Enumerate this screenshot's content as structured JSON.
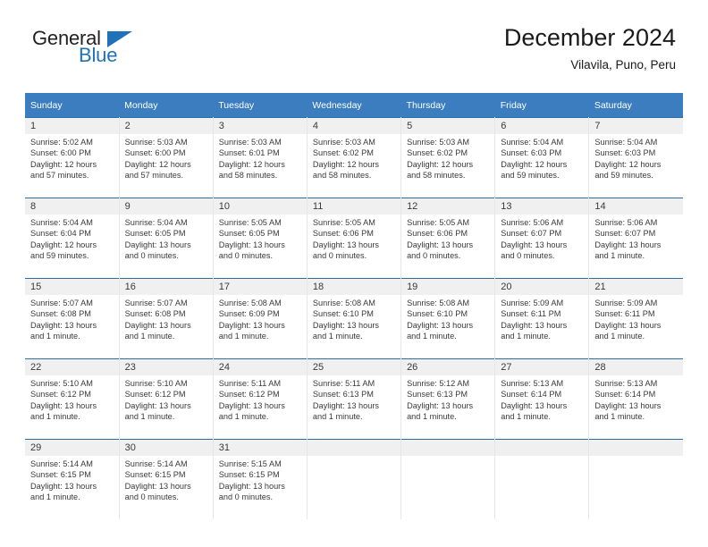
{
  "branding": {
    "name_primary": "General",
    "name_secondary": "Blue",
    "flag_icon": "triangle-flag-icon"
  },
  "header": {
    "title": "December 2024",
    "location": "Vilavila, Puno, Peru"
  },
  "colors": {
    "header_blue": "#3b7dbf",
    "row_divider_blue": "#2e6da4",
    "daynum_band": "#f0f0f0",
    "logo_blue": "#1f72b8",
    "text": "#3a3a3a"
  },
  "calendar": {
    "weekday_headers": [
      "Sunday",
      "Monday",
      "Tuesday",
      "Wednesday",
      "Thursday",
      "Friday",
      "Saturday"
    ],
    "weeks": [
      [
        {
          "day": "1",
          "sunrise": "Sunrise: 5:02 AM",
          "sunset": "Sunset: 6:00 PM",
          "daylight_1": "Daylight: 12 hours",
          "daylight_2": "and 57 minutes."
        },
        {
          "day": "2",
          "sunrise": "Sunrise: 5:03 AM",
          "sunset": "Sunset: 6:00 PM",
          "daylight_1": "Daylight: 12 hours",
          "daylight_2": "and 57 minutes."
        },
        {
          "day": "3",
          "sunrise": "Sunrise: 5:03 AM",
          "sunset": "Sunset: 6:01 PM",
          "daylight_1": "Daylight: 12 hours",
          "daylight_2": "and 58 minutes."
        },
        {
          "day": "4",
          "sunrise": "Sunrise: 5:03 AM",
          "sunset": "Sunset: 6:02 PM",
          "daylight_1": "Daylight: 12 hours",
          "daylight_2": "and 58 minutes."
        },
        {
          "day": "5",
          "sunrise": "Sunrise: 5:03 AM",
          "sunset": "Sunset: 6:02 PM",
          "daylight_1": "Daylight: 12 hours",
          "daylight_2": "and 58 minutes."
        },
        {
          "day": "6",
          "sunrise": "Sunrise: 5:04 AM",
          "sunset": "Sunset: 6:03 PM",
          "daylight_1": "Daylight: 12 hours",
          "daylight_2": "and 59 minutes."
        },
        {
          "day": "7",
          "sunrise": "Sunrise: 5:04 AM",
          "sunset": "Sunset: 6:03 PM",
          "daylight_1": "Daylight: 12 hours",
          "daylight_2": "and 59 minutes."
        }
      ],
      [
        {
          "day": "8",
          "sunrise": "Sunrise: 5:04 AM",
          "sunset": "Sunset: 6:04 PM",
          "daylight_1": "Daylight: 12 hours",
          "daylight_2": "and 59 minutes."
        },
        {
          "day": "9",
          "sunrise": "Sunrise: 5:04 AM",
          "sunset": "Sunset: 6:05 PM",
          "daylight_1": "Daylight: 13 hours",
          "daylight_2": "and 0 minutes."
        },
        {
          "day": "10",
          "sunrise": "Sunrise: 5:05 AM",
          "sunset": "Sunset: 6:05 PM",
          "daylight_1": "Daylight: 13 hours",
          "daylight_2": "and 0 minutes."
        },
        {
          "day": "11",
          "sunrise": "Sunrise: 5:05 AM",
          "sunset": "Sunset: 6:06 PM",
          "daylight_1": "Daylight: 13 hours",
          "daylight_2": "and 0 minutes."
        },
        {
          "day": "12",
          "sunrise": "Sunrise: 5:05 AM",
          "sunset": "Sunset: 6:06 PM",
          "daylight_1": "Daylight: 13 hours",
          "daylight_2": "and 0 minutes."
        },
        {
          "day": "13",
          "sunrise": "Sunrise: 5:06 AM",
          "sunset": "Sunset: 6:07 PM",
          "daylight_1": "Daylight: 13 hours",
          "daylight_2": "and 0 minutes."
        },
        {
          "day": "14",
          "sunrise": "Sunrise: 5:06 AM",
          "sunset": "Sunset: 6:07 PM",
          "daylight_1": "Daylight: 13 hours",
          "daylight_2": "and 1 minute."
        }
      ],
      [
        {
          "day": "15",
          "sunrise": "Sunrise: 5:07 AM",
          "sunset": "Sunset: 6:08 PM",
          "daylight_1": "Daylight: 13 hours",
          "daylight_2": "and 1 minute."
        },
        {
          "day": "16",
          "sunrise": "Sunrise: 5:07 AM",
          "sunset": "Sunset: 6:08 PM",
          "daylight_1": "Daylight: 13 hours",
          "daylight_2": "and 1 minute."
        },
        {
          "day": "17",
          "sunrise": "Sunrise: 5:08 AM",
          "sunset": "Sunset: 6:09 PM",
          "daylight_1": "Daylight: 13 hours",
          "daylight_2": "and 1 minute."
        },
        {
          "day": "18",
          "sunrise": "Sunrise: 5:08 AM",
          "sunset": "Sunset: 6:10 PM",
          "daylight_1": "Daylight: 13 hours",
          "daylight_2": "and 1 minute."
        },
        {
          "day": "19",
          "sunrise": "Sunrise: 5:08 AM",
          "sunset": "Sunset: 6:10 PM",
          "daylight_1": "Daylight: 13 hours",
          "daylight_2": "and 1 minute."
        },
        {
          "day": "20",
          "sunrise": "Sunrise: 5:09 AM",
          "sunset": "Sunset: 6:11 PM",
          "daylight_1": "Daylight: 13 hours",
          "daylight_2": "and 1 minute."
        },
        {
          "day": "21",
          "sunrise": "Sunrise: 5:09 AM",
          "sunset": "Sunset: 6:11 PM",
          "daylight_1": "Daylight: 13 hours",
          "daylight_2": "and 1 minute."
        }
      ],
      [
        {
          "day": "22",
          "sunrise": "Sunrise: 5:10 AM",
          "sunset": "Sunset: 6:12 PM",
          "daylight_1": "Daylight: 13 hours",
          "daylight_2": "and 1 minute."
        },
        {
          "day": "23",
          "sunrise": "Sunrise: 5:10 AM",
          "sunset": "Sunset: 6:12 PM",
          "daylight_1": "Daylight: 13 hours",
          "daylight_2": "and 1 minute."
        },
        {
          "day": "24",
          "sunrise": "Sunrise: 5:11 AM",
          "sunset": "Sunset: 6:12 PM",
          "daylight_1": "Daylight: 13 hours",
          "daylight_2": "and 1 minute."
        },
        {
          "day": "25",
          "sunrise": "Sunrise: 5:11 AM",
          "sunset": "Sunset: 6:13 PM",
          "daylight_1": "Daylight: 13 hours",
          "daylight_2": "and 1 minute."
        },
        {
          "day": "26",
          "sunrise": "Sunrise: 5:12 AM",
          "sunset": "Sunset: 6:13 PM",
          "daylight_1": "Daylight: 13 hours",
          "daylight_2": "and 1 minute."
        },
        {
          "day": "27",
          "sunrise": "Sunrise: 5:13 AM",
          "sunset": "Sunset: 6:14 PM",
          "daylight_1": "Daylight: 13 hours",
          "daylight_2": "and 1 minute."
        },
        {
          "day": "28",
          "sunrise": "Sunrise: 5:13 AM",
          "sunset": "Sunset: 6:14 PM",
          "daylight_1": "Daylight: 13 hours",
          "daylight_2": "and 1 minute."
        }
      ],
      [
        {
          "day": "29",
          "sunrise": "Sunrise: 5:14 AM",
          "sunset": "Sunset: 6:15 PM",
          "daylight_1": "Daylight: 13 hours",
          "daylight_2": "and 1 minute."
        },
        {
          "day": "30",
          "sunrise": "Sunrise: 5:14 AM",
          "sunset": "Sunset: 6:15 PM",
          "daylight_1": "Daylight: 13 hours",
          "daylight_2": "and 0 minutes."
        },
        {
          "day": "31",
          "sunrise": "Sunrise: 5:15 AM",
          "sunset": "Sunset: 6:15 PM",
          "daylight_1": "Daylight: 13 hours",
          "daylight_2": "and 0 minutes."
        },
        {
          "day": "",
          "sunrise": "",
          "sunset": "",
          "daylight_1": "",
          "daylight_2": ""
        },
        {
          "day": "",
          "sunrise": "",
          "sunset": "",
          "daylight_1": "",
          "daylight_2": ""
        },
        {
          "day": "",
          "sunrise": "",
          "sunset": "",
          "daylight_1": "",
          "daylight_2": ""
        },
        {
          "day": "",
          "sunrise": "",
          "sunset": "",
          "daylight_1": "",
          "daylight_2": ""
        }
      ]
    ]
  }
}
